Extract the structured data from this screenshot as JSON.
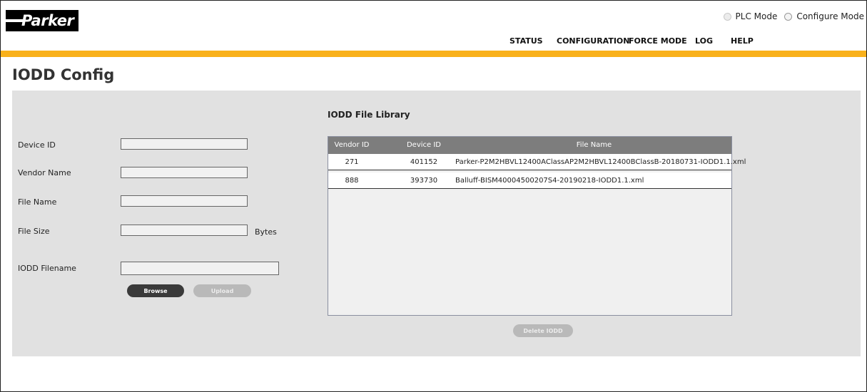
{
  "brand": {
    "logo_text": "Parker"
  },
  "modes": [
    {
      "label": "PLC Mode"
    },
    {
      "label": "Configure Mode"
    }
  ],
  "nav": [
    {
      "label": "STATUS"
    },
    {
      "label": "CONFIGURATION"
    },
    {
      "label": "FORCE MODE"
    },
    {
      "label": "LOG"
    },
    {
      "label": "HELP"
    }
  ],
  "page": {
    "title": "IODD Config"
  },
  "form": {
    "device_id_label": "Device ID",
    "device_id_value": "",
    "vendor_name_label": "Vendor Name",
    "vendor_name_value": "",
    "file_name_label": "File Name",
    "file_name_value": "",
    "file_size_label": "File Size",
    "file_size_value": "",
    "file_size_unit": "Bytes",
    "iodd_filename_label": "IODD Filename",
    "iodd_filename_value": "",
    "browse_label": "Browse",
    "upload_label": "Upload"
  },
  "library": {
    "title": "IODD File Library",
    "columns": [
      "Vendor ID",
      "Device ID",
      "File Name"
    ],
    "rows": [
      {
        "vendor_id": "271",
        "device_id": "401152",
        "file_name": "Parker-P2M2HBVL12400AClassAP2M2HBVL12400BClassB-20180731-IODD1.1.xml"
      },
      {
        "vendor_id": "888",
        "device_id": "393730",
        "file_name": "Balluff-BISM40004500207S4-20190218-IODD1.1.xml"
      }
    ],
    "delete_label": "Delete IODD"
  },
  "colors": {
    "accent_stripe": "#f9b11b",
    "panel": "#e1e1e1",
    "table_header": "#7d7d7d"
  }
}
